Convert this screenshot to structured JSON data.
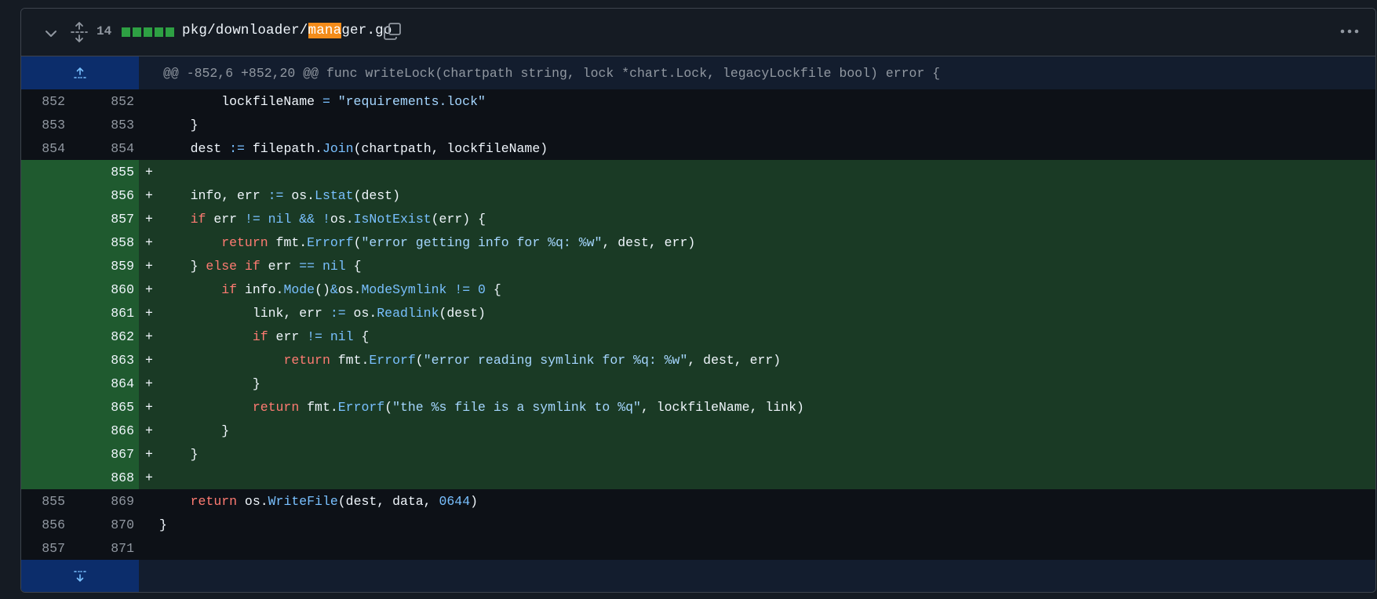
{
  "file": {
    "additions_count": "14",
    "path_before": "pkg/downloader/",
    "path_highlight": "mana",
    "path_after": "ger.go"
  },
  "hunk_header": "@@ -852,6 +852,20 @@ func writeLock(chartpath string, lock *chart.Lock, legacyLockfile bool) error {",
  "colors": {
    "added_row": "#1a3a25",
    "added_gutter": "#1f5a2f",
    "expander": "#0c2d6b",
    "keyword": "#ff7b72",
    "function": "#79c0ff",
    "highlight": "#f48c1a"
  },
  "rows": [
    {
      "type": "ctx",
      "old": "852",
      "new": "852",
      "tokens": [
        {
          "t": "        lockfileName "
        },
        {
          "t": "=",
          "c": "op"
        },
        {
          "t": " "
        },
        {
          "t": "\"requirements.lock\"",
          "c": "str"
        }
      ]
    },
    {
      "type": "ctx",
      "old": "853",
      "new": "853",
      "tokens": [
        {
          "t": "    }"
        }
      ]
    },
    {
      "type": "ctx",
      "old": "854",
      "new": "854",
      "tokens": [
        {
          "t": "    dest "
        },
        {
          "t": ":=",
          "c": "op"
        },
        {
          "t": " filepath."
        },
        {
          "t": "Join",
          "c": "fn"
        },
        {
          "t": "(chartpath, lockfileName)"
        }
      ]
    },
    {
      "type": "add",
      "old": "",
      "new": "855",
      "tokens": []
    },
    {
      "type": "add",
      "old": "",
      "new": "856",
      "tokens": [
        {
          "t": "    info, err "
        },
        {
          "t": ":=",
          "c": "op"
        },
        {
          "t": " os."
        },
        {
          "t": "Lstat",
          "c": "fn"
        },
        {
          "t": "(dest)"
        }
      ]
    },
    {
      "type": "add",
      "old": "",
      "new": "857",
      "tokens": [
        {
          "t": "    "
        },
        {
          "t": "if",
          "c": "kw"
        },
        {
          "t": " err "
        },
        {
          "t": "!=",
          "c": "op"
        },
        {
          "t": " "
        },
        {
          "t": "nil",
          "c": "nil"
        },
        {
          "t": " "
        },
        {
          "t": "&&",
          "c": "op"
        },
        {
          "t": " "
        },
        {
          "t": "!",
          "c": "op"
        },
        {
          "t": "os."
        },
        {
          "t": "IsNotExist",
          "c": "fn"
        },
        {
          "t": "(err) {"
        }
      ]
    },
    {
      "type": "add",
      "old": "",
      "new": "858",
      "tokens": [
        {
          "t": "        "
        },
        {
          "t": "return",
          "c": "kw"
        },
        {
          "t": " fmt."
        },
        {
          "t": "Errorf",
          "c": "fn"
        },
        {
          "t": "("
        },
        {
          "t": "\"error getting info for %q: %w\"",
          "c": "str"
        },
        {
          "t": ", dest, err)"
        }
      ]
    },
    {
      "type": "add",
      "old": "",
      "new": "859",
      "tokens": [
        {
          "t": "    } "
        },
        {
          "t": "else",
          "c": "kw"
        },
        {
          "t": " "
        },
        {
          "t": "if",
          "c": "kw"
        },
        {
          "t": " err "
        },
        {
          "t": "==",
          "c": "op"
        },
        {
          "t": " "
        },
        {
          "t": "nil",
          "c": "nil"
        },
        {
          "t": " {"
        }
      ]
    },
    {
      "type": "add",
      "old": "",
      "new": "860",
      "tokens": [
        {
          "t": "        "
        },
        {
          "t": "if",
          "c": "kw"
        },
        {
          "t": " info."
        },
        {
          "t": "Mode",
          "c": "fn"
        },
        {
          "t": "()"
        },
        {
          "t": "&",
          "c": "op"
        },
        {
          "t": "os."
        },
        {
          "t": "ModeSymlink",
          "c": "fn"
        },
        {
          "t": " "
        },
        {
          "t": "!=",
          "c": "op"
        },
        {
          "t": " "
        },
        {
          "t": "0",
          "c": "nil"
        },
        {
          "t": " {"
        }
      ]
    },
    {
      "type": "add",
      "old": "",
      "new": "861",
      "tokens": [
        {
          "t": "            link, err "
        },
        {
          "t": ":=",
          "c": "op"
        },
        {
          "t": " os."
        },
        {
          "t": "Readlink",
          "c": "fn"
        },
        {
          "t": "(dest)"
        }
      ]
    },
    {
      "type": "add",
      "old": "",
      "new": "862",
      "tokens": [
        {
          "t": "            "
        },
        {
          "t": "if",
          "c": "kw"
        },
        {
          "t": " err "
        },
        {
          "t": "!=",
          "c": "op"
        },
        {
          "t": " "
        },
        {
          "t": "nil",
          "c": "nil"
        },
        {
          "t": " {"
        }
      ]
    },
    {
      "type": "add",
      "old": "",
      "new": "863",
      "tokens": [
        {
          "t": "                "
        },
        {
          "t": "return",
          "c": "kw"
        },
        {
          "t": " fmt."
        },
        {
          "t": "Errorf",
          "c": "fn"
        },
        {
          "t": "("
        },
        {
          "t": "\"error reading symlink for %q: %w\"",
          "c": "str"
        },
        {
          "t": ", dest, err)"
        }
      ]
    },
    {
      "type": "add",
      "old": "",
      "new": "864",
      "tokens": [
        {
          "t": "            }"
        }
      ]
    },
    {
      "type": "add",
      "old": "",
      "new": "865",
      "tokens": [
        {
          "t": "            "
        },
        {
          "t": "return",
          "c": "kw"
        },
        {
          "t": " fmt."
        },
        {
          "t": "Errorf",
          "c": "fn"
        },
        {
          "t": "("
        },
        {
          "t": "\"the %s file is a symlink to %q\"",
          "c": "str"
        },
        {
          "t": ", lockfileName, link)"
        }
      ]
    },
    {
      "type": "add",
      "old": "",
      "new": "866",
      "tokens": [
        {
          "t": "        }"
        }
      ]
    },
    {
      "type": "add",
      "old": "",
      "new": "867",
      "tokens": [
        {
          "t": "    }"
        }
      ]
    },
    {
      "type": "add",
      "old": "",
      "new": "868",
      "tokens": []
    },
    {
      "type": "ctx",
      "old": "855",
      "new": "869",
      "tokens": [
        {
          "t": "    "
        },
        {
          "t": "return",
          "c": "kw"
        },
        {
          "t": " os."
        },
        {
          "t": "WriteFile",
          "c": "fn"
        },
        {
          "t": "(dest, data, "
        },
        {
          "t": "0644",
          "c": "nil"
        },
        {
          "t": ")"
        }
      ]
    },
    {
      "type": "ctx",
      "old": "856",
      "new": "870",
      "tokens": [
        {
          "t": "}"
        }
      ]
    },
    {
      "type": "ctx",
      "old": "857",
      "new": "871",
      "tokens": []
    }
  ]
}
